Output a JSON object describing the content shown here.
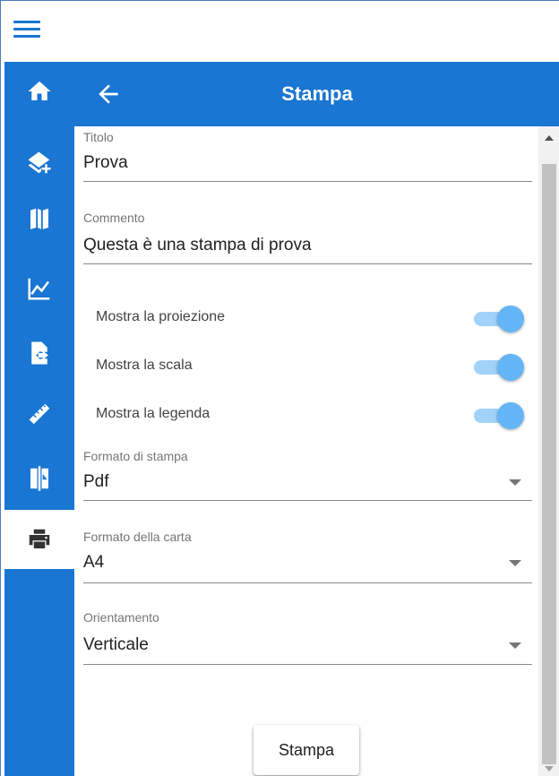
{
  "header": {
    "title": "Stampa"
  },
  "sidebar": {
    "items": [
      {
        "icon": "home-icon"
      },
      {
        "icon": "add-layer-icon"
      },
      {
        "icon": "map-icon"
      },
      {
        "icon": "chart-line-icon"
      },
      {
        "icon": "file-export-icon"
      },
      {
        "icon": "ruler-icon"
      },
      {
        "icon": "compare-icon"
      },
      {
        "icon": "printer-icon",
        "active": true
      }
    ]
  },
  "form": {
    "titolo": {
      "label": "Titolo",
      "value": "Prova"
    },
    "commento": {
      "label": "Commento",
      "value": "Questa è una stampa di prova"
    },
    "switches": [
      {
        "label": "Mostra la proiezione",
        "on": true
      },
      {
        "label": "Mostra la scala",
        "on": true
      },
      {
        "label": "Mostra la legenda",
        "on": true
      }
    ],
    "formato_stampa": {
      "label": "Formato di stampa",
      "value": "Pdf"
    },
    "formato_carta": {
      "label": "Formato della carta",
      "value": "A4"
    },
    "orientamento": {
      "label": "Orientamento",
      "value": "Verticale"
    },
    "print_button": "Stampa"
  },
  "colors": {
    "primary": "#1976d2",
    "switch_thumb": "#64b5f6",
    "switch_track": "#90caf9"
  }
}
